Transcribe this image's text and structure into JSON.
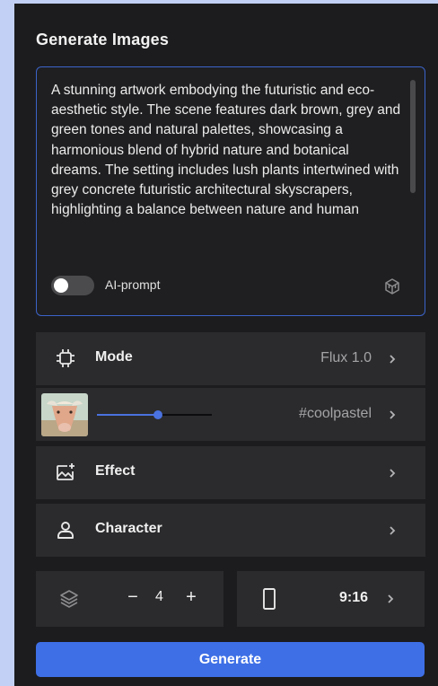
{
  "panel": {
    "title": "Generate Images"
  },
  "prompt": {
    "text": "A stunning artwork embodying the futuristic and eco-aesthetic style. The scene features dark brown, grey and green tones and natural palettes, showcasing a harmonious blend of hybrid nature and botanical dreams. The setting includes lush plants intertwined with grey concrete futuristic architectural skyscrapers, highlighting a balance between nature and human",
    "ai_prompt_label": "AI-prompt",
    "ai_prompt_enabled": false
  },
  "rows": {
    "mode": {
      "label": "Mode",
      "value": "Flux 1.0",
      "icon": "processor-chip-icon"
    },
    "style": {
      "value": "#coolpastel",
      "strength": 0.53,
      "icon": "cow-thumbnail"
    },
    "effect": {
      "label": "Effect",
      "icon": "image-sparkle-icon"
    },
    "character": {
      "label": "Character",
      "icon": "person-icon"
    }
  },
  "count": {
    "minus": "−",
    "value": "4",
    "plus": "+",
    "icon": "layers-icon"
  },
  "ratio": {
    "value": "9:16",
    "icon": "portrait-frame-icon"
  },
  "actions": {
    "generate_label": "Generate"
  },
  "colors": {
    "accent": "#3e6fe6",
    "panel": "#1c1c1e",
    "row": "#2b2b2d",
    "background": "#c2d0f6"
  }
}
